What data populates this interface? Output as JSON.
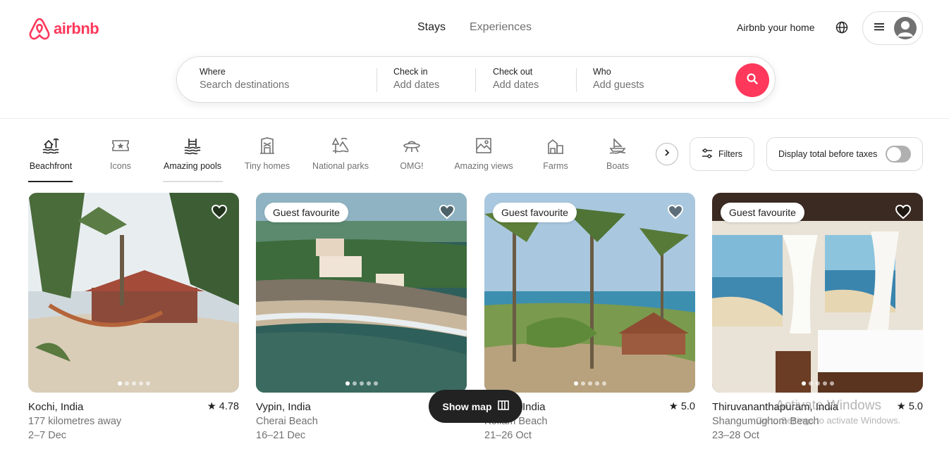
{
  "brand": {
    "name": "airbnb",
    "color": "#ff385c"
  },
  "header": {
    "tabs": [
      "Stays",
      "Experiences"
    ],
    "host_link": "Airbnb your home",
    "icons": {
      "globe": "globe-icon",
      "menu": "hamburger-menu-icon",
      "avatar": "user-avatar-icon"
    }
  },
  "search": {
    "where": {
      "label": "Where",
      "placeholder": "Search destinations"
    },
    "checkin": {
      "label": "Check in",
      "placeholder": "Add dates"
    },
    "checkout": {
      "label": "Check out",
      "placeholder": "Add dates"
    },
    "who": {
      "label": "Who",
      "placeholder": "Add guests"
    },
    "button_icon": "search-icon"
  },
  "categories": [
    {
      "label": "Beachfront",
      "icon": "beachfront-icon",
      "active": true
    },
    {
      "label": "Icons",
      "icon": "icons-ticket-icon",
      "active": false
    },
    {
      "label": "Amazing pools",
      "icon": "pool-icon",
      "active": false
    },
    {
      "label": "Tiny homes",
      "icon": "tiny-home-icon",
      "active": false
    },
    {
      "label": "National parks",
      "icon": "national-park-icon",
      "active": false
    },
    {
      "label": "OMG!",
      "icon": "ufo-icon",
      "active": false
    },
    {
      "label": "Amazing views",
      "icon": "view-icon",
      "active": false
    },
    {
      "label": "Farms",
      "icon": "farm-icon",
      "active": false
    },
    {
      "label": "Boats",
      "icon": "boat-icon",
      "active": false
    }
  ],
  "filters": {
    "label": "Filters",
    "icon": "sliders-icon"
  },
  "taxes_toggle": {
    "label": "Display total before taxes",
    "on": false
  },
  "listings": [
    {
      "title": "Kochi, India",
      "rating": "4.78",
      "line2": "177 kilometres away",
      "dates": "2–7 Dec",
      "badge": "",
      "photo_count": 5,
      "active_photo": 0
    },
    {
      "title": "Vypin, India",
      "rating": "",
      "line2": "Cherai Beach",
      "dates": "16–21 Dec",
      "badge": "Guest favourite",
      "photo_count": 5,
      "active_photo": 0
    },
    {
      "title": "India",
      "rating": "5.0",
      "line2": "Kollam Beach",
      "dates": "21–26 Oct",
      "badge": "Guest favourite",
      "photo_count": 5,
      "active_photo": 0
    },
    {
      "title": "Thiruvananthapuram, India",
      "rating": "5.0",
      "line2": "Shangumughom Beach",
      "dates": "23–28 Oct",
      "badge": "Guest favourite",
      "photo_count": 5,
      "active_photo": 0
    }
  ],
  "show_map": {
    "label": "Show map",
    "icon": "map-icon"
  },
  "windows_watermark": {
    "line1": "Activate Windows",
    "line2": "Go to Settings to activate Windows."
  }
}
